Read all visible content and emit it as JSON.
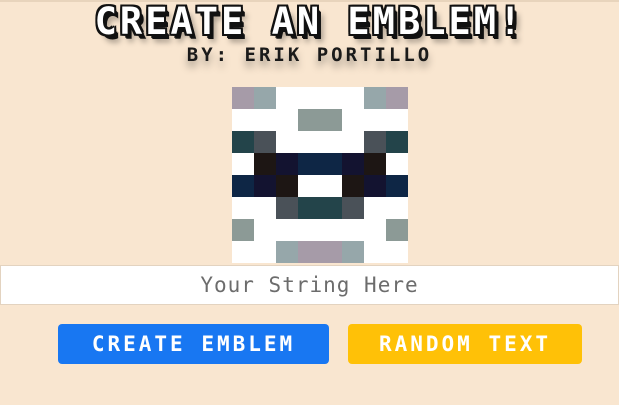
{
  "header": {
    "title": "CREATE AN EMBLEM!",
    "byline": "BY: ERIK PORTILLO"
  },
  "emblem": {
    "grid_size": 8,
    "colors": [
      [
        "#a69ba8",
        "#96a7aa",
        "#ffffff",
        "#ffffff",
        "#ffffff",
        "#ffffff",
        "#96a7aa",
        "#a69ba8"
      ],
      [
        "#ffffff",
        "#ffffff",
        "#ffffff",
        "#8c9a96",
        "#8c9a96",
        "#ffffff",
        "#ffffff",
        "#ffffff"
      ],
      [
        "#23444a",
        "#4a5158",
        "#ffffff",
        "#ffffff",
        "#ffffff",
        "#ffffff",
        "#4a5158",
        "#23444a"
      ],
      [
        "#ffffff",
        "#1d1614",
        "#131330",
        "#0e2645",
        "#0e2645",
        "#131330",
        "#1d1614",
        "#ffffff"
      ],
      [
        "#0e2645",
        "#131330",
        "#1d1614",
        "#ffffff",
        "#ffffff",
        "#1d1614",
        "#131330",
        "#0e2645"
      ],
      [
        "#ffffff",
        "#ffffff",
        "#4a5158",
        "#23444a",
        "#23444a",
        "#4a5158",
        "#ffffff",
        "#ffffff"
      ],
      [
        "#8c9a96",
        "#ffffff",
        "#ffffff",
        "#ffffff",
        "#ffffff",
        "#ffffff",
        "#ffffff",
        "#8c9a96"
      ],
      [
        "#ffffff",
        "#ffffff",
        "#96a7aa",
        "#a69ba8",
        "#a69ba8",
        "#96a7aa",
        "#ffffff",
        "#ffffff"
      ]
    ]
  },
  "input": {
    "placeholder": "Your String Here",
    "value": ""
  },
  "buttons": {
    "create_label": "CREATE EMBLEM",
    "random_label": "RANDOM TEXT",
    "create_color": "#1877f2",
    "random_color": "#ffc107"
  },
  "background_color": "#f9e6d0"
}
